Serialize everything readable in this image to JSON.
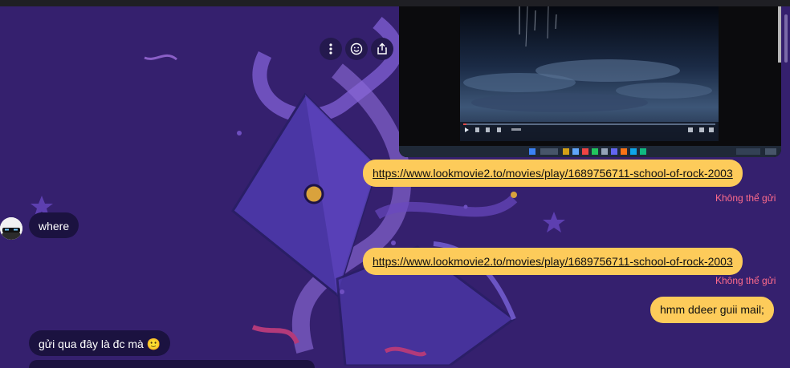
{
  "colors": {
    "background": "#35206e",
    "outgoing_bubble": "#fdcb5a",
    "incoming_bubble": "#1b1240",
    "error_text": "#ff6b8b"
  },
  "message_actions": [
    "more-icon",
    "emoji-icon",
    "share-icon"
  ],
  "messages": [
    {
      "direction": "out",
      "text": "https://www.lookmovie2.to/movies/play/1689756711-school-of-rock-2003",
      "status": "Không thể gửi"
    },
    {
      "direction": "in",
      "text": "where"
    },
    {
      "direction": "out",
      "text": "https://www.lookmovie2.to/movies/play/1689756711-school-of-rock-2003",
      "status": "Không thể gửi"
    },
    {
      "direction": "out",
      "text": "hmm ddeer guii mail;"
    },
    {
      "direction": "in",
      "text": "gửi qua đây là đc mà 🙂"
    }
  ]
}
